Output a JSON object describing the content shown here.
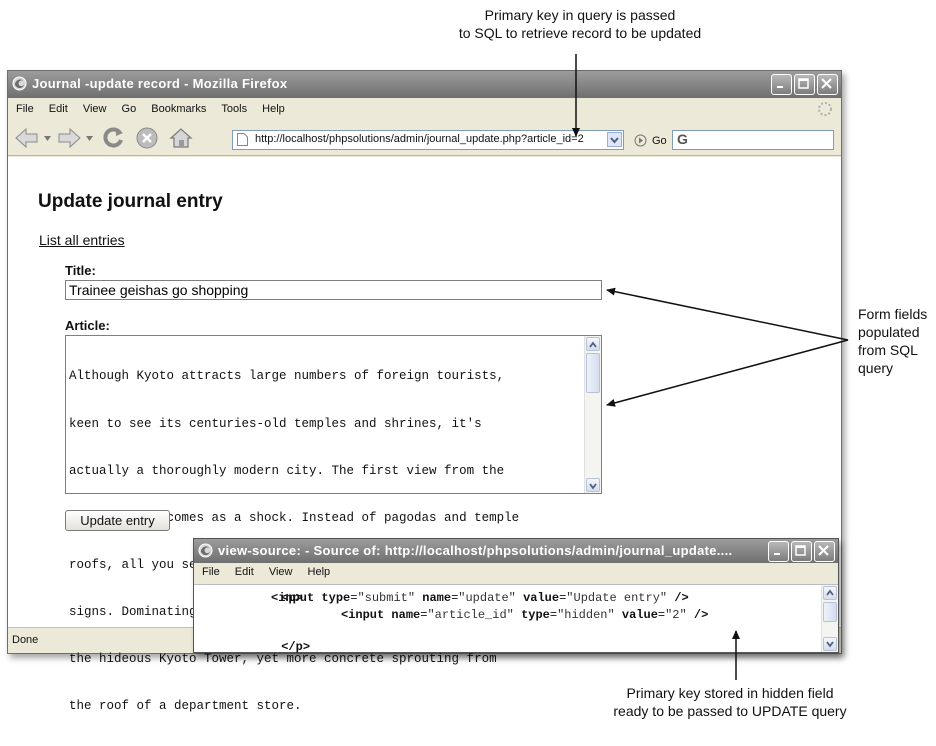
{
  "annotations": {
    "top": [
      "Primary key in query is passed",
      "to SQL to retrieve record to be updated"
    ],
    "right": [
      "Form fields",
      "populated",
      "from SQL",
      "query"
    ],
    "bottom": [
      "Primary key stored in hidden field",
      "ready to be passed to UPDATE query"
    ]
  },
  "browser": {
    "title": "Journal -update record - Mozilla Firefox",
    "menu": {
      "file": "File",
      "edit": "Edit",
      "view": "View",
      "go": "Go",
      "bookmarks": "Bookmarks",
      "tools": "Tools",
      "help": "Help"
    },
    "url": "http://localhost/phpsolutions/admin/journal_update.php?article_id=2",
    "go_label": "Go",
    "search_glyph": "G",
    "status": "Done"
  },
  "page": {
    "heading": "Update journal entry",
    "list_link": "List all entries",
    "title_label": "Title:",
    "title_value": "Trainee geishas go shopping",
    "article_label": "Article:",
    "article_lines": [
      "Although Kyoto attracts large numbers of foreign tourists,",
      "keen to see its centuries-old temples and shrines, it's",
      "actually a thoroughly modern city. The first view from the",
      "bullet train comes as a shock. Instead of pagodas and temple",
      "roofs, all you see is a jumble of concrete blocks and neon",
      "signs. Dominating the skyline just outside Kyoto station is",
      "the hideous Kyoto Tower, yet more concrete sprouting from",
      "the roof of a department store."
    ],
    "submit_label": "Update entry"
  },
  "source_window": {
    "title": "view-source: - Source of: http://localhost/phpsolutions/admin/journal_update....",
    "menu": {
      "file": "File",
      "edit": "Edit",
      "view": "View",
      "help": "Help"
    },
    "line0": "<p>",
    "line1": {
      "open": "<input",
      "a1": "type",
      "v1": "\"submit\"",
      "a2": "name",
      "v2": "\"update\"",
      "a3": "value",
      "v3": "\"Update entry\"",
      "close": "/>"
    },
    "line2": {
      "open": "<input",
      "a1": "name",
      "v1": "\"article_id\"",
      "a2": "type",
      "v2": "\"hidden\"",
      "a3": "value",
      "v3": "\"2\"",
      "close": "/>"
    },
    "line3": "</p>"
  }
}
